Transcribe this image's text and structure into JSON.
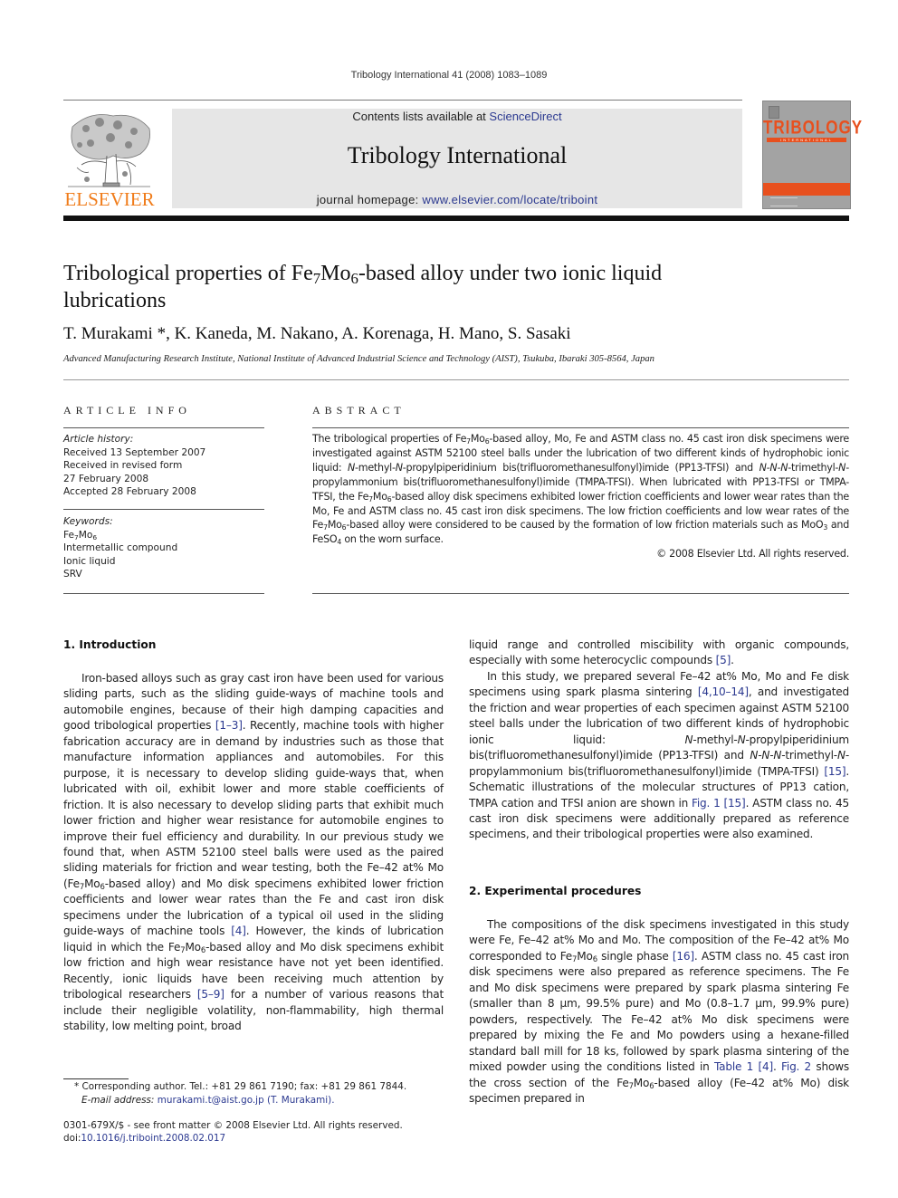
{
  "running_head": "Tribology International 41 (2008) 1083–1089",
  "masthead": {
    "contents_prefix": "Contents lists available at ",
    "contents_link": "ScienceDirect",
    "journal_name": "Tribology International",
    "homepage_prefix": "journal homepage: ",
    "homepage_link": "www.elsevier.com/locate/triboint",
    "publisher_word": "ELSEVIER",
    "cover_title": "TRIBOLOGY",
    "cover_subtitle": "INTERNATIONAL",
    "colors": {
      "publisher_orange": "#f07c1a",
      "cover_orange": "#e8501e",
      "link_blue": "#2b3990"
    }
  },
  "article": {
    "title_part1": "Tribological properties of Fe",
    "title_sub1": "7",
    "title_mid": "Mo",
    "title_sub2": "6",
    "title_part2": "-based alloy under two ionic liquid lubrications",
    "authors": "T. Murakami *, K. Kaneda, M. Nakano, A. Korenaga, H. Mano, S. Sasaki",
    "affiliation": "Advanced Manufacturing Research Institute, National Institute of Advanced Industrial Science and Technology (AIST), Tsukuba, Ibaraki 305-8564, Japan"
  },
  "article_info": {
    "heading": "ARTICLE INFO",
    "history_caption": "Article history:",
    "history": [
      "Received 13 September 2007",
      "Received in revised form",
      "27 February 2008",
      "Accepted 28 February 2008"
    ],
    "keywords_caption": "Keywords:",
    "keywords": [
      "Fe7Mo6",
      "Intermetallic compound",
      "Ionic liquid",
      "SRV"
    ]
  },
  "abstract": {
    "heading": "ABSTRACT",
    "p1a": "The tribological properties of Fe",
    "p1b": "-based alloy, Mo, Fe and ASTM class no. 45 cast iron disk specimens were investigated against ASTM 52100 steel balls under the lubrication of two different kinds of hydrophobic ionic liquid: ",
    "italic_n1": "N",
    "t1": "-methyl-",
    "italic_n2": "N",
    "t2": "-propylpiperidinium bis(trifluoromethanesulfonyl)imide (PP13-TFSI) and ",
    "italic_nnn": "N-N-N",
    "t3": "-trimethyl-",
    "italic_n3": "N",
    "t4": "-propylammonium bis(trifluoromethanesulfonyl)imide (TMPA-TFSI). When lubricated with PP13-TFSI or TMPA-TFSI, the Fe",
    "t5": "-based alloy disk specimens exhibited lower friction coefficients and lower wear rates than the Mo, Fe and ASTM class no. 45 cast iron disk specimens. The low friction coefficients and low wear rates of the Fe",
    "t6": "-based alloy were considered to be caused by the formation of low friction materials such as MoO",
    "t7": " and FeSO",
    "t8": " on the worn surface.",
    "copyright": "© 2008 Elsevier Ltd. All rights reserved."
  },
  "sections": {
    "intro_heading": "1.  Introduction",
    "exp_heading": "2.  Experimental procedures"
  },
  "intro": {
    "a": "Iron-based alloys such as gray cast iron have been used for various sliding parts, such as the sliding guide-ways of machine tools and automobile engines, because of their high damping capacities and good tribological properties ",
    "ref1": "[1–3]",
    "b": ". Recently, machine tools with higher fabrication accuracy are in demand by industries such as those that manufacture information appliances and automobiles. For this purpose, it is necessary to develop sliding guide-ways that, when lubricated with oil, exhibit lower and more stable coefficients of friction. It is also necessary to develop sliding parts that exhibit much lower friction and higher wear resistance for automobile engines to improve their fuel efficiency and durability. In our previous study we found that, when ASTM 52100 steel balls were used as the paired sliding materials for friction and wear testing, both the Fe–42 at% Mo (Fe",
    "c": "-based alloy) and Mo disk specimens exhibited lower friction coefficients and lower wear rates than the Fe and cast iron disk specimens under the lubrication of a typical oil used in the sliding guide-ways of machine tools ",
    "ref2": "[4]",
    "d": ". However, the kinds of lubrication liquid in which the Fe",
    "e": "-based alloy and Mo disk specimens exhibit low friction and high wear resistance have not yet been identified. Recently, ionic liquids have been receiving much attention by tribological researchers ",
    "ref3": "[5–9]",
    "f": " for a number of various reasons that include their negligible volatility, non-flammability, high thermal stability, low melting point, broad"
  },
  "right_a": {
    "a": "liquid range and controlled miscibility with organic compounds, especially with some heterocyclic compounds ",
    "ref1": "[5]",
    "b": ".",
    "p2a": "In this study, we prepared several Fe–42 at% Mo, Mo and Fe disk specimens using spark plasma sintering ",
    "ref2": "[4,10–14]",
    "p2b": ", and investigated the friction and wear properties of each specimen against ASTM 52100 steel balls under the lubrication of two different kinds of hydrophobic ionic liquid: ",
    "n1": "N",
    "p2c": "-methyl-",
    "n2": "N",
    "p2d": "-propylpi­peridinium bis(trifluoromethanesulfonyl)imide (PP13-TFSI) and ",
    "nnn": "N-N-N",
    "p2e": "-trimethyl-",
    "n3": "N",
    "p2f": "-propylammonium bis(trifluoromethanesulfo­nyl)imide (TMPA-TFSI) ",
    "ref3": "[15]",
    "p2g": ". Schematic illustrations of the mole­cular structures of PP13 cation, TMPA cation and TFSI anion are shown in ",
    "ref4": "Fig. 1",
    "p2h": " ",
    "ref5": "[15]",
    "p2i": ". ASTM class no. 45 cast iron disk specimens were additionally prepared as reference specimens, and their tribological properties were also examined."
  },
  "right_b": {
    "a": "The compositions of the disk specimens investigated in this study were Fe, Fe–42 at% Mo and Mo. The composition of the Fe–42 at% Mo corresponded to Fe",
    "b": " single phase ",
    "ref1": "[16]",
    "c": ". ASTM class no. 45 cast iron disk specimens were also prepared as reference specimens. The Fe and Mo disk specimens were prepared by spark plasma sintering Fe (smaller than 8 μm, 99.5% pure) and Mo (0.8–1.7 μm, 99.9% pure) powders, respectively. The Fe–42 at% Mo disk specimens were prepared by mixing the Fe and Mo powders using a hexane-filled standard ball mill for 18 ks, followed by spark plasma sintering of the mixed powder using the conditions listed in ",
    "ref2": "Table 1",
    "d": " ",
    "ref3": "[4]",
    "e": ". ",
    "ref4": "Fig. 2",
    "f": " shows the cross section of the Fe",
    "g": "-based alloy (Fe–42 at% Mo) disk specimen prepared in"
  },
  "chem": {
    "fe": "Fe",
    "mo": "Mo",
    "s7": "7",
    "s6": "6",
    "s3": "3",
    "s4": "4"
  },
  "footnotes": {
    "corr": "* Corresponding author. Tel.: +81 29 861 7190; fax: +81 29 861 7844.",
    "email_label": "E-mail address: ",
    "email": "murakami.t@aist.go.jp (T. Murakami).",
    "issn": "0301-679X/$ - see front matter © 2008 Elsevier Ltd. All rights reserved.",
    "doi_label": "doi:",
    "doi": "10.1016/j.triboint.2008.02.017"
  }
}
